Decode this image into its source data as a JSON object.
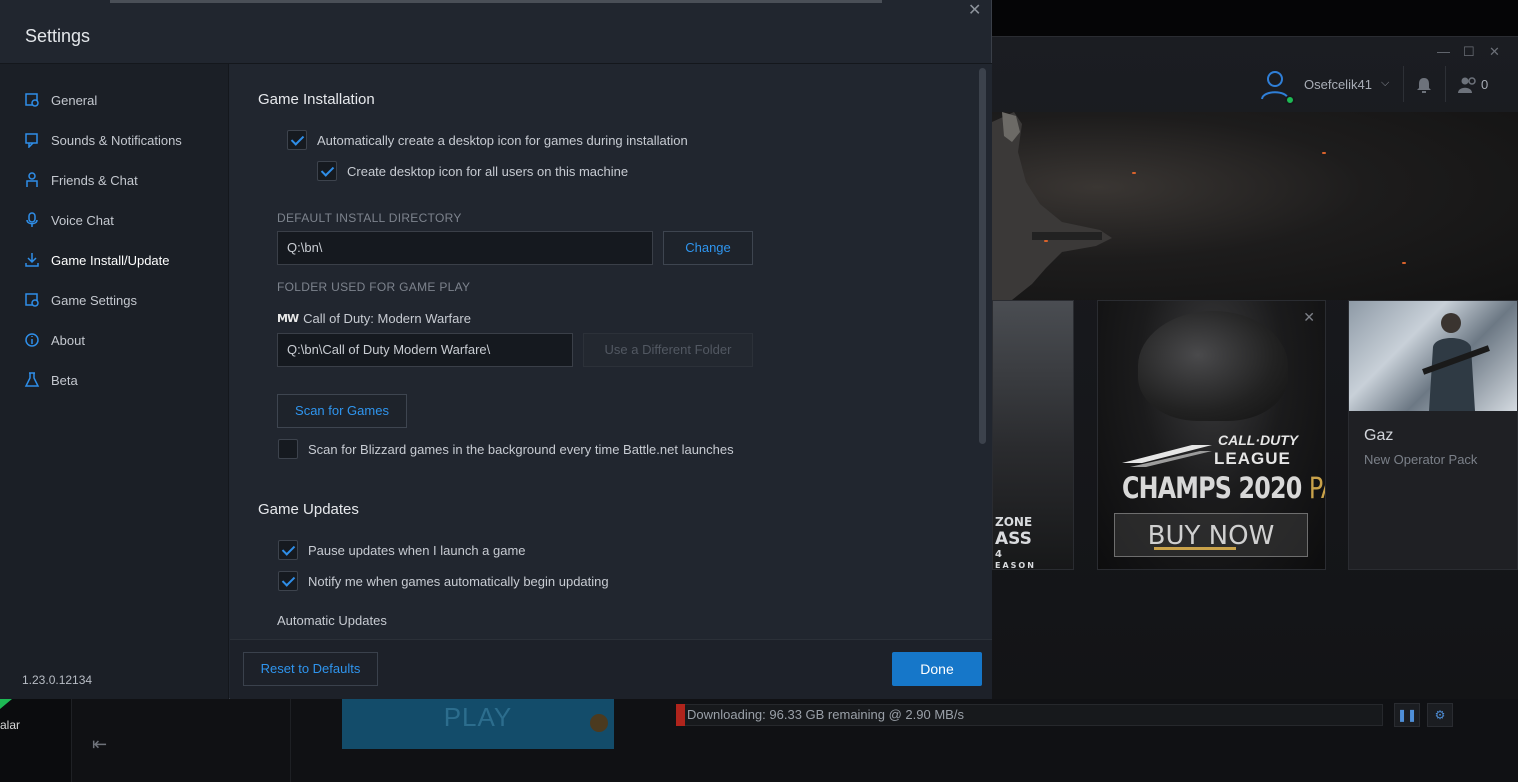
{
  "settings": {
    "title": "Settings",
    "close_glyph": "✕",
    "version": "1.23.0.12134",
    "nav": [
      {
        "label": "General",
        "icon": "general-icon"
      },
      {
        "label": "Sounds & Notifications",
        "icon": "sound-icon"
      },
      {
        "label": "Friends & Chat",
        "icon": "friends-chat-icon"
      },
      {
        "label": "Voice Chat",
        "icon": "microphone-icon"
      },
      {
        "label": "Game Install/Update",
        "icon": "download-icon",
        "active": true
      },
      {
        "label": "Game Settings",
        "icon": "game-settings-icon"
      },
      {
        "label": "About",
        "icon": "info-icon"
      },
      {
        "label": "Beta",
        "icon": "flask-icon"
      }
    ],
    "install": {
      "section_title": "Game Installation",
      "desktop_icon_label": "Automatically create a desktop icon for games during installation",
      "desktop_icon_checked": true,
      "all_users_label": "Create desktop icon for all users on this machine",
      "all_users_checked": true,
      "default_dir_label": "DEFAULT INSTALL DIRECTORY",
      "default_dir_value": "Q:\\bn\\",
      "change_label": "Change",
      "folder_label": "FOLDER USED FOR GAME PLAY",
      "game_logo_text": "MW",
      "game_name": "Call of Duty: Modern Warfare",
      "game_folder_value": "Q:\\bn\\Call of Duty Modern Warfare\\",
      "different_folder_label": "Use a Different Folder",
      "scan_label": "Scan for Games",
      "scan_bg_label": "Scan for Blizzard games in the background every time Battle.net launches",
      "scan_bg_checked": false
    },
    "updates": {
      "section_title": "Game Updates",
      "pause_label": "Pause updates when I launch a game",
      "pause_checked": true,
      "notify_label": "Notify me when games automatically begin updating",
      "notify_checked": true,
      "auto_updates_label": "Automatic Updates"
    },
    "footer": {
      "reset_label": "Reset to Defaults",
      "done_label": "Done"
    }
  },
  "background": {
    "window_controls": [
      "—",
      "☐",
      "✕"
    ],
    "username": "Osefcelik41",
    "friend_count": "0",
    "card_a_lines": [
      "ZONE",
      "ASS",
      "4",
      "EASON"
    ],
    "promo": {
      "logo_line1": "CALL·DUTY",
      "logo_line2": "LEAGUE",
      "headline_main": "CHAMPS 2020 ",
      "headline_accent": "PACK",
      "cta": "BUY NOW"
    },
    "operator": {
      "title": "Gaz",
      "subtitle": "New Operator Pack"
    },
    "side_text": "alar",
    "play_label": "PLAY",
    "download_text": "Downloading: 96.33 GB remaining @ 2.90 MB/s",
    "download_progress": 0.013,
    "accent_blue": "#1677c9",
    "link_blue": "#2f95ee"
  }
}
